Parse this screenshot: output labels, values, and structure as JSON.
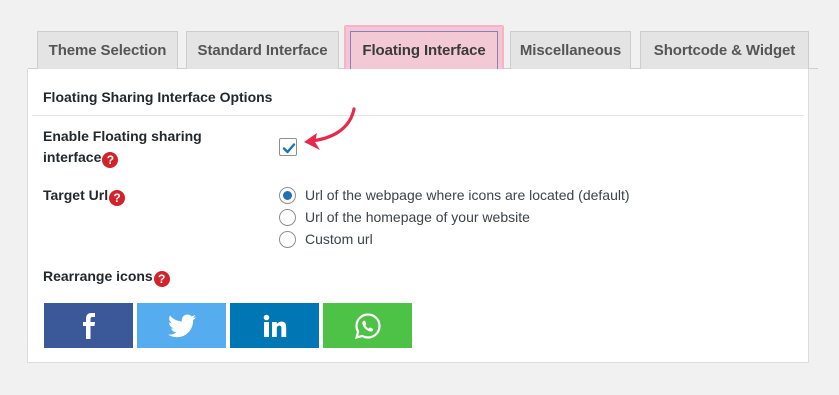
{
  "tabs": [
    {
      "label": "Theme Selection"
    },
    {
      "label": "Standard Interface"
    },
    {
      "label": "Floating Interface",
      "active": true
    },
    {
      "label": "Miscellaneous"
    },
    {
      "label": "Shortcode & Widget"
    }
  ],
  "panel": {
    "title": "Floating Sharing Interface Options",
    "enable_floating": {
      "label_line1": "Enable Floating sharing",
      "label_line2": "interface",
      "checked": true
    },
    "target_url": {
      "label": "Target Url",
      "options": [
        {
          "label": "Url of the webpage where icons are located (default)",
          "selected": true
        },
        {
          "label": "Url of the homepage of your website",
          "selected": false
        },
        {
          "label": "Custom url",
          "selected": false
        }
      ]
    },
    "rearrange": {
      "label": "Rearrange icons",
      "icons": [
        {
          "name": "facebook-icon",
          "color": "#3b5998"
        },
        {
          "name": "twitter-icon",
          "color": "#55acee"
        },
        {
          "name": "linkedin-icon",
          "color": "#0077b5"
        },
        {
          "name": "whatsapp-icon",
          "color": "#4dc247"
        }
      ]
    }
  },
  "colors": {
    "help_badge": "#d2232a",
    "arrow": "#e8294d",
    "active_tab_highlight": "#f4c9d6"
  }
}
